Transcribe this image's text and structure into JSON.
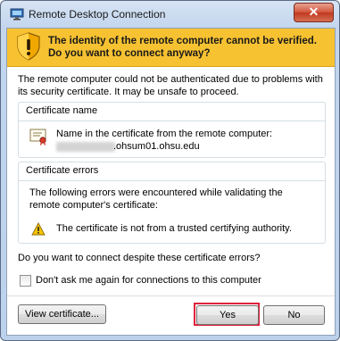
{
  "window": {
    "title": "Remote Desktop Connection",
    "close_glyph": "✕",
    "app_icon": "remote-desktop-icon"
  },
  "warning": {
    "icon": "shield-warning-icon",
    "headline": "The identity of the remote computer cannot be verified. Do you want to connect anyway?"
  },
  "intro": "The remote computer could not be authenticated due to problems with its security certificate. It may be unsafe to proceed.",
  "certificate_name": {
    "label": "Certificate name",
    "icon": "certificate-icon",
    "line": "Name in the certificate from the remote computer:",
    "host_suffix": ".ohsum01.ohsu.edu"
  },
  "certificate_errors": {
    "label": "Certificate errors",
    "intro": "The following errors were encountered while validating the remote computer's certificate:",
    "items": [
      {
        "icon": "warning-triangle-icon",
        "text": "The certificate is not from a trusted certifying authority."
      }
    ]
  },
  "question": "Do you want to connect despite these certificate errors?",
  "dont_ask": {
    "label": "Don't ask me again for connections to this computer",
    "checked": false
  },
  "buttons": {
    "view_certificate": "View certificate...",
    "yes": "Yes",
    "no": "No"
  },
  "colors": {
    "warning_bar": "#f7c231",
    "highlight_outline": "#e0203a"
  }
}
